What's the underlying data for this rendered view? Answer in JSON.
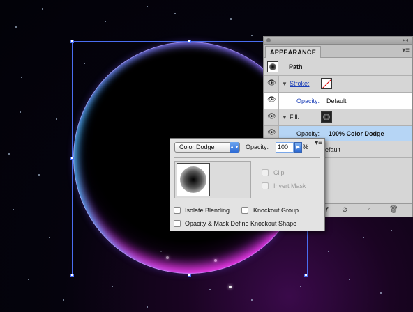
{
  "appearance_panel": {
    "tab": "APPEARANCE",
    "object_type": "Path",
    "stroke_label": "Stroke:",
    "stroke_opacity_label": "Opacity:",
    "stroke_opacity_value": "Default",
    "fill_label": "Fill:",
    "fill_opacity_label": "Opacity:",
    "fill_opacity_value": "100% Color Dodge",
    "bottom_row_partial": "efault"
  },
  "transparency_popup": {
    "blend_mode": "Color Dodge",
    "opacity_label": "Opacity:",
    "opacity_value": "100",
    "percent_sign": "%",
    "clip_label": "Clip",
    "invert_mask_label": "Invert Mask",
    "isolate_blending_label": "Isolate Blending",
    "knockout_group_label": "Knockout Group",
    "opacity_mask_knockout_label": "Opacity & Mask Define Knockout Shape"
  },
  "colors": {
    "selection_bbox": "#4a6df0",
    "sphere_cyan": "#37d2ff",
    "sphere_magenta": "#ff3df4",
    "sphere_violet": "#8a7bff",
    "selected_row": "#b6d5f5"
  },
  "icons": [
    "eye-icon",
    "triangle-down-icon",
    "panel-menu-icon",
    "close-icon",
    "no-icon",
    "new-item-icon",
    "trash-icon",
    "dropdown-arrow-icon",
    "stepper-arrow-icon"
  ]
}
